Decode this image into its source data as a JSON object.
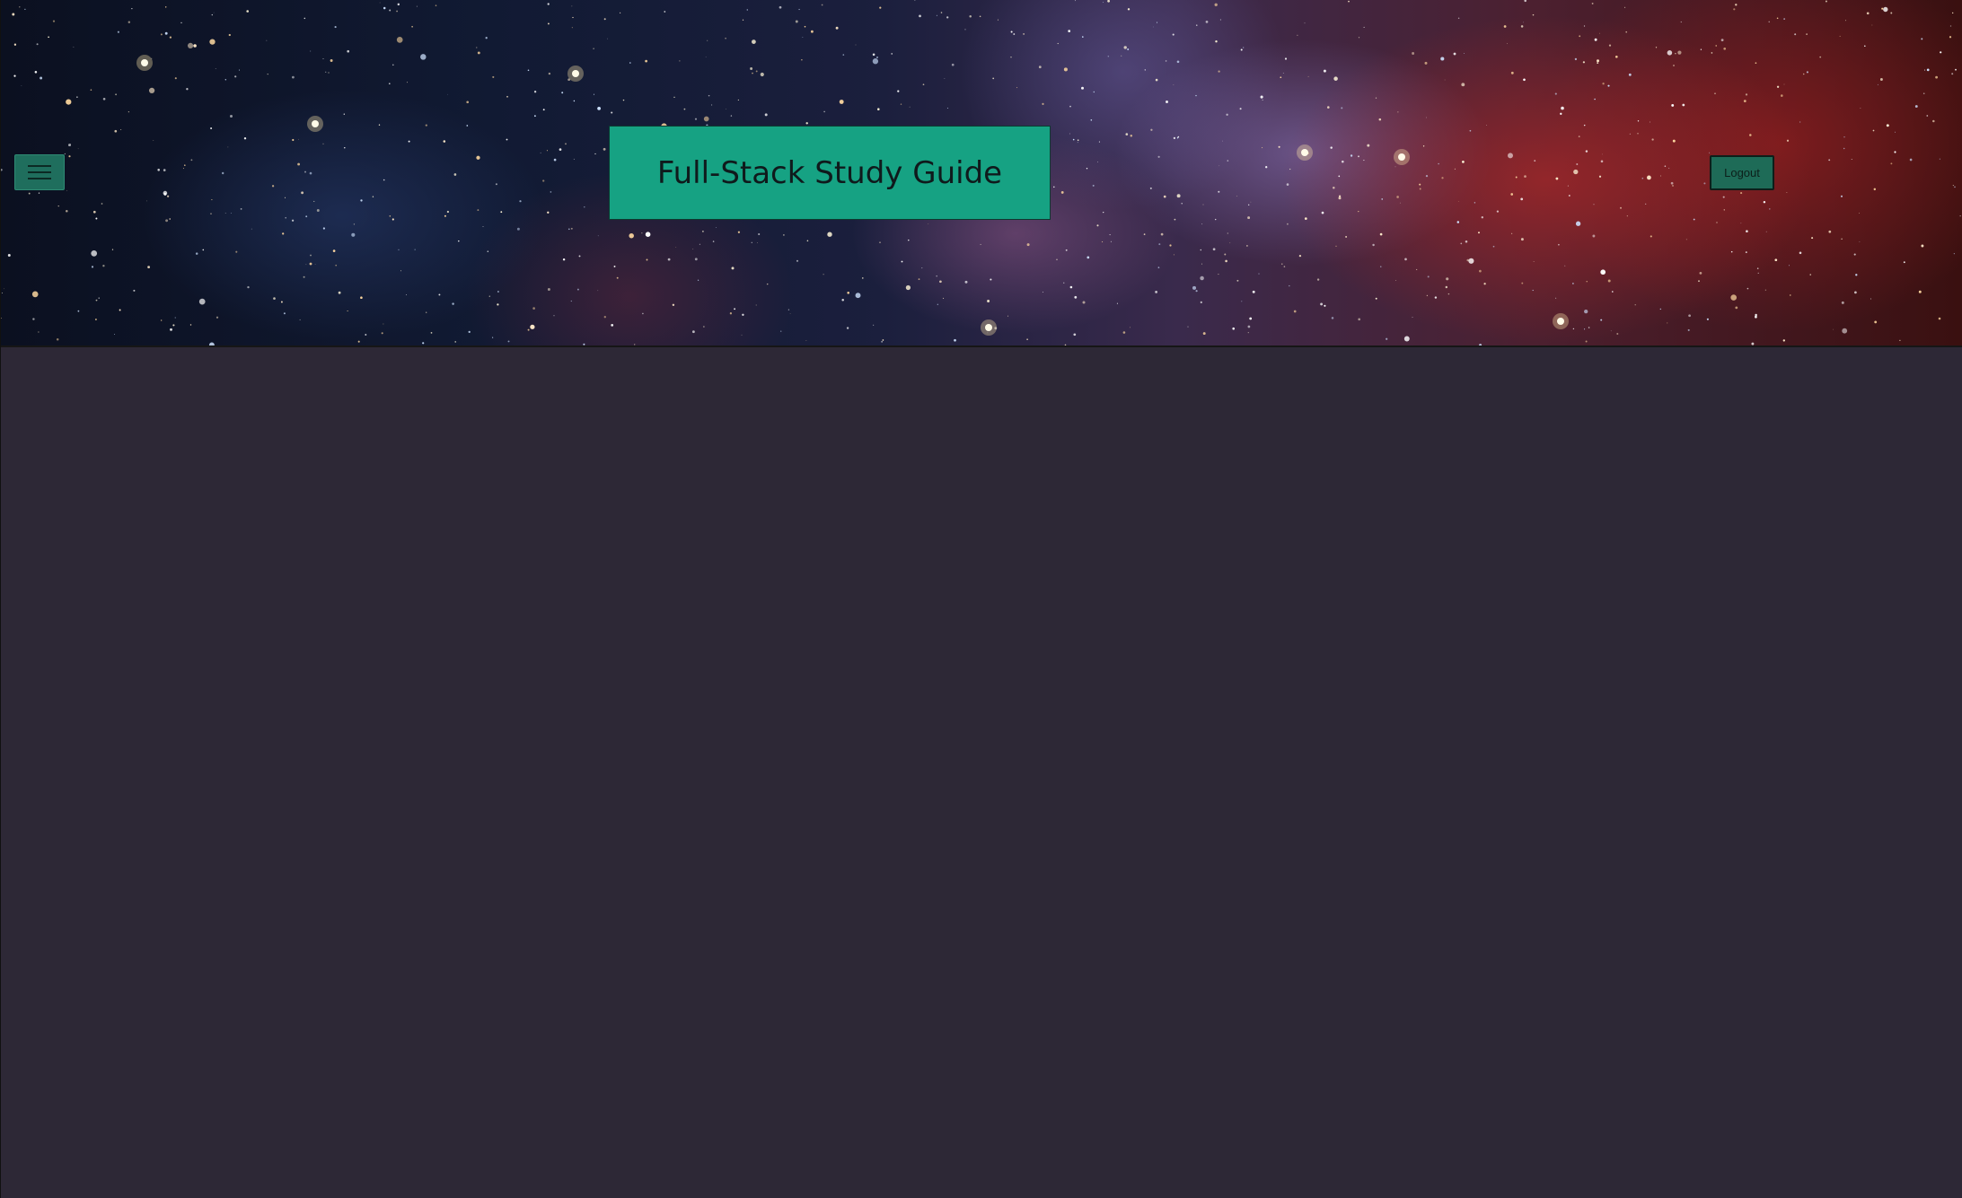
{
  "header": {
    "title": "Full-Stack Study Guide",
    "menu_icon": "hamburger-icon",
    "logout_label": "Logout"
  },
  "colors": {
    "accent": "#16a283",
    "button": "#1e6b57",
    "background": "#2d2836"
  }
}
